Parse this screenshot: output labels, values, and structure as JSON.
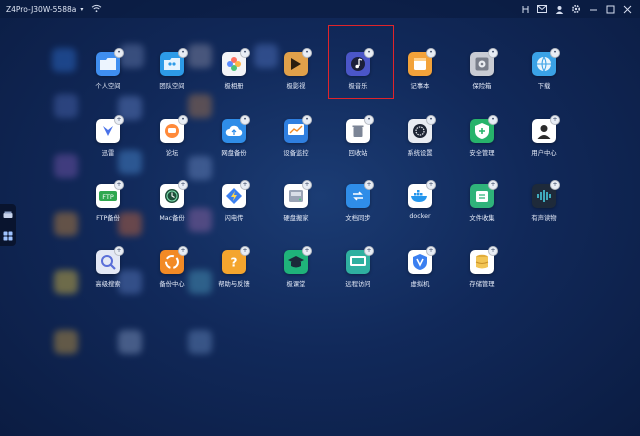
{
  "topbar": {
    "device_name": "Z4Pro-J30W-5588a",
    "dropdown_icon": "chevron-down-icon",
    "wifi_icon": "wifi-icon",
    "right_icons": [
      "pin-icon",
      "mail-icon",
      "user-icon",
      "gear-icon",
      "minimize-icon",
      "maximize-icon",
      "close-icon"
    ]
  },
  "dock": {
    "items": [
      "drive-icon",
      "apps-grid-icon"
    ]
  },
  "apps": [
    {
      "label": "个人空间",
      "icon": "folder-icon",
      "color": "#3f8ef0",
      "badge": "lock"
    },
    {
      "label": "团队空间",
      "icon": "team-folder-icon",
      "color": "#2d9be8",
      "badge": "lock"
    },
    {
      "label": "极相册",
      "icon": "photos-icon",
      "color": "#f4f4f7",
      "badge": "lock"
    },
    {
      "label": "极影视",
      "icon": "video-icon",
      "color": "#e0a04a",
      "badge": "lock"
    },
    {
      "label": "极音乐",
      "icon": "music-icon",
      "color": "#4b56c8",
      "badge": "lock"
    },
    {
      "label": "记事本",
      "icon": "notepad-icon",
      "color": "#f2a23a",
      "badge": "lock"
    },
    {
      "label": "保险箱",
      "icon": "safe-icon",
      "color": "#c9ccd3",
      "badge": "lock"
    },
    {
      "label": "下载",
      "icon": "download-globe-icon",
      "color": "#3aa2e6",
      "badge": "lock"
    },
    {
      "label": "迅雷",
      "icon": "thunder-icon",
      "color": "#ffffff",
      "badge": "plus"
    },
    {
      "label": "论坛",
      "icon": "forum-icon",
      "color": "#ffffff",
      "badge": "lock"
    },
    {
      "label": "网盘备份",
      "icon": "cloud-backup-icon",
      "color": "#2f8de8",
      "badge": "lock"
    },
    {
      "label": "设备监控",
      "icon": "monitor-chart-icon",
      "color": "#2f7fe0",
      "badge": "lock"
    },
    {
      "label": "回收站",
      "icon": "trash-icon",
      "color": "#ffffff",
      "badge": "lock"
    },
    {
      "label": "系统设置",
      "icon": "settings-icon",
      "color": "#e9ecf2",
      "badge": "lock"
    },
    {
      "label": "安全管理",
      "icon": "shield-plus-icon",
      "color": "#27b36b",
      "badge": "lock"
    },
    {
      "label": "用户中心",
      "icon": "user-center-icon",
      "color": "#ffffff",
      "badge": "plus"
    },
    {
      "label": "FTP备份",
      "icon": "ftp-icon",
      "color": "#ffffff",
      "badge": "plus"
    },
    {
      "label": "Mac备份",
      "icon": "time-machine-icon",
      "color": "#ffffff",
      "badge": "plus"
    },
    {
      "label": "闪电传",
      "icon": "flash-transfer-icon",
      "color": "#ffffff",
      "badge": "plus"
    },
    {
      "label": "硬盘搬家",
      "icon": "disk-move-icon",
      "color": "#ffffff",
      "badge": "plus"
    },
    {
      "label": "文档同步",
      "icon": "sync-icon",
      "color": "#2f8de8",
      "badge": "plus"
    },
    {
      "label": "docker",
      "icon": "docker-icon",
      "color": "#ffffff",
      "badge": "plus"
    },
    {
      "label": "文件收集",
      "icon": "file-collect-icon",
      "color": "#2fb37a",
      "badge": "plus"
    },
    {
      "label": "有声读物",
      "icon": "audiobook-icon",
      "color": "#1e2a3a",
      "badge": "plus"
    },
    {
      "label": "高级搜索",
      "icon": "search-icon",
      "color": "#e3e8f5",
      "badge": "plus"
    },
    {
      "label": "备份中心",
      "icon": "backup-center-icon",
      "color": "#f28a25",
      "badge": "plus"
    },
    {
      "label": "帮助与反馈",
      "icon": "help-icon",
      "color": "#f4a52e",
      "badge": "plus"
    },
    {
      "label": "极课堂",
      "icon": "graduation-icon",
      "color": "#1fb37a",
      "badge": "plus"
    },
    {
      "label": "远程访问",
      "icon": "remote-access-icon",
      "color": "#2fb0a0",
      "badge": "plus"
    },
    {
      "label": "虚拟机",
      "icon": "vm-icon",
      "color": "#ffffff",
      "badge": "plus"
    },
    {
      "label": "存储管理",
      "icon": "storage-icon",
      "color": "#ffffff",
      "badge": "plus"
    }
  ],
  "selected_app": "极音乐"
}
